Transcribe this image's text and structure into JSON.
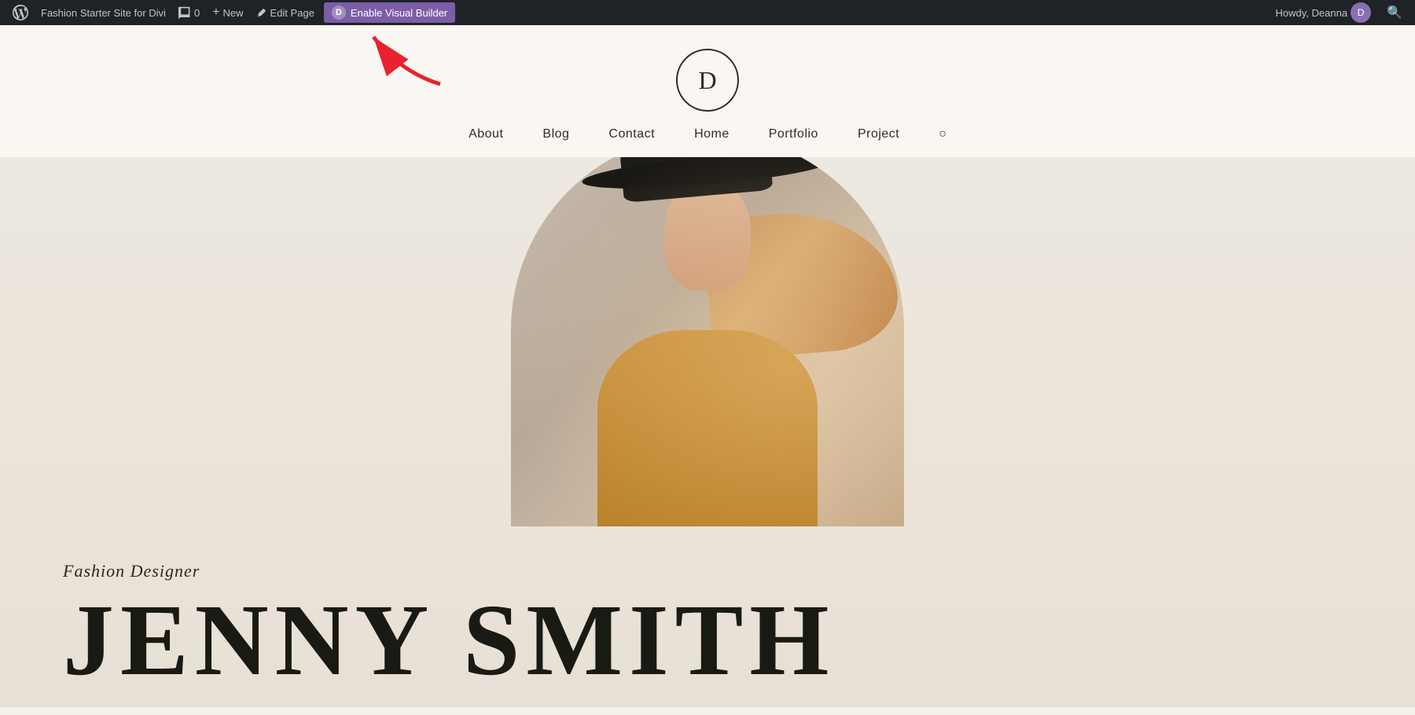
{
  "admin_bar": {
    "site_title": "Fashion Starter Site for Divi",
    "comments_label": "0",
    "new_label": "New",
    "edit_page_label": "Edit Page",
    "enable_visual_builder_label": "Enable Visual Builder",
    "divi_letter": "D",
    "howdy_label": "Howdy, Deanna"
  },
  "nav": {
    "logo_letter": "D",
    "links": [
      {
        "label": "About"
      },
      {
        "label": "Blog"
      },
      {
        "label": "Contact"
      },
      {
        "label": "Home"
      },
      {
        "label": "Portfolio"
      },
      {
        "label": "Project"
      }
    ]
  },
  "hero": {
    "sub_label": "Fashion Designer",
    "name": "JENNY SMITH"
  },
  "colors": {
    "admin_bg": "#1d2327",
    "admin_text": "#c3c4c7",
    "divi_purple": "#7b5ea7",
    "site_bg": "#faf6f1",
    "hero_bg": "#f0ebe3",
    "text_dark": "#2c2c2c",
    "hero_name_color": "#1a1a14"
  }
}
